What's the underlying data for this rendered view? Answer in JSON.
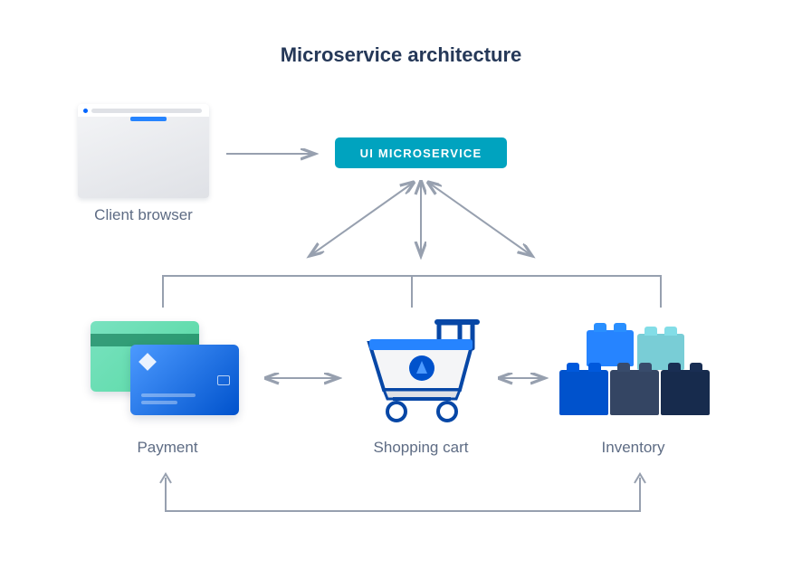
{
  "title": "Microservice architecture",
  "nodes": {
    "client_browser": {
      "label": "Client browser"
    },
    "ui_microservice": {
      "label": "UI MICROSERVICE"
    },
    "payment": {
      "label": "Payment"
    },
    "shopping_cart": {
      "label": "Shopping cart"
    },
    "inventory": {
      "label": "Inventory"
    }
  },
  "edges": [
    {
      "from": "client_browser",
      "to": "ui_microservice",
      "bidirectional": false
    },
    {
      "from": "ui_microservice",
      "to": "payment",
      "bidirectional": true
    },
    {
      "from": "ui_microservice",
      "to": "shopping_cart",
      "bidirectional": true
    },
    {
      "from": "ui_microservice",
      "to": "inventory",
      "bidirectional": true
    },
    {
      "from": "payment",
      "to": "shopping_cart",
      "bidirectional": true
    },
    {
      "from": "shopping_cart",
      "to": "inventory",
      "bidirectional": true
    },
    {
      "from": "payment",
      "to": "inventory",
      "bidirectional": false,
      "via": "bottom"
    }
  ],
  "colors": {
    "arrow": "#97a0af",
    "pill_bg": "#00a3bf",
    "text": "#42526e",
    "title": "#253858"
  }
}
